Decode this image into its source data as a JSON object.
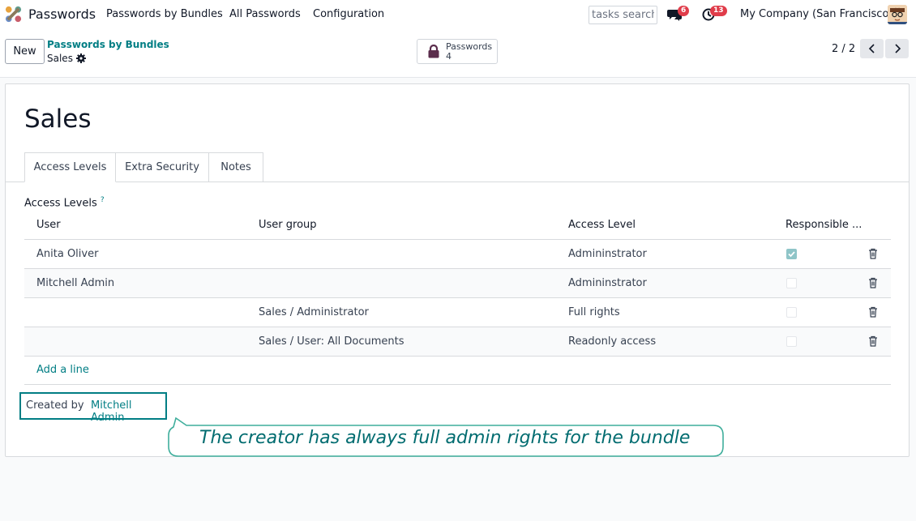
{
  "navbar": {
    "app_name": "Passwords",
    "menu": [
      "Passwords by Bundles",
      "All Passwords",
      "Configuration"
    ],
    "search_value": "tasks search",
    "messages_count": "6",
    "activities_count": "13",
    "company": "My Company (San Francisco)"
  },
  "control": {
    "new_label": "New",
    "breadcrumb_parent": "Passwords by Bundles",
    "breadcrumb_current": "Sales",
    "smart_button": {
      "label": "Passwords",
      "count": "4"
    },
    "pager": "2 / 2"
  },
  "form": {
    "title": "Sales",
    "tabs": [
      "Access Levels",
      "Extra Security",
      "Notes"
    ],
    "section_label": "Access Levels",
    "section_help": "?",
    "columns": [
      "User",
      "User group",
      "Access Level",
      "Responsible ..."
    ],
    "rows": [
      {
        "user": "Anita Oliver",
        "group": "",
        "access": "Admininstrator",
        "responsible": true
      },
      {
        "user": "Mitchell Admin",
        "group": "",
        "access": "Admininstrator",
        "responsible": false
      },
      {
        "user": "",
        "group": "Sales / Administrator",
        "access": "Full rights",
        "responsible": false
      },
      {
        "user": "",
        "group": "Sales / User: All Documents",
        "access": "Readonly access",
        "responsible": false
      }
    ],
    "add_line": "Add a line",
    "created_by_label": "Created by",
    "created_by_value": "Mitchell Admin"
  },
  "annotation": "The creator has always full admin rights for the bundle",
  "colors": {
    "accent": "#017e84",
    "badge": "#e03c4a",
    "checkbox_on": "#8fc5c8"
  }
}
